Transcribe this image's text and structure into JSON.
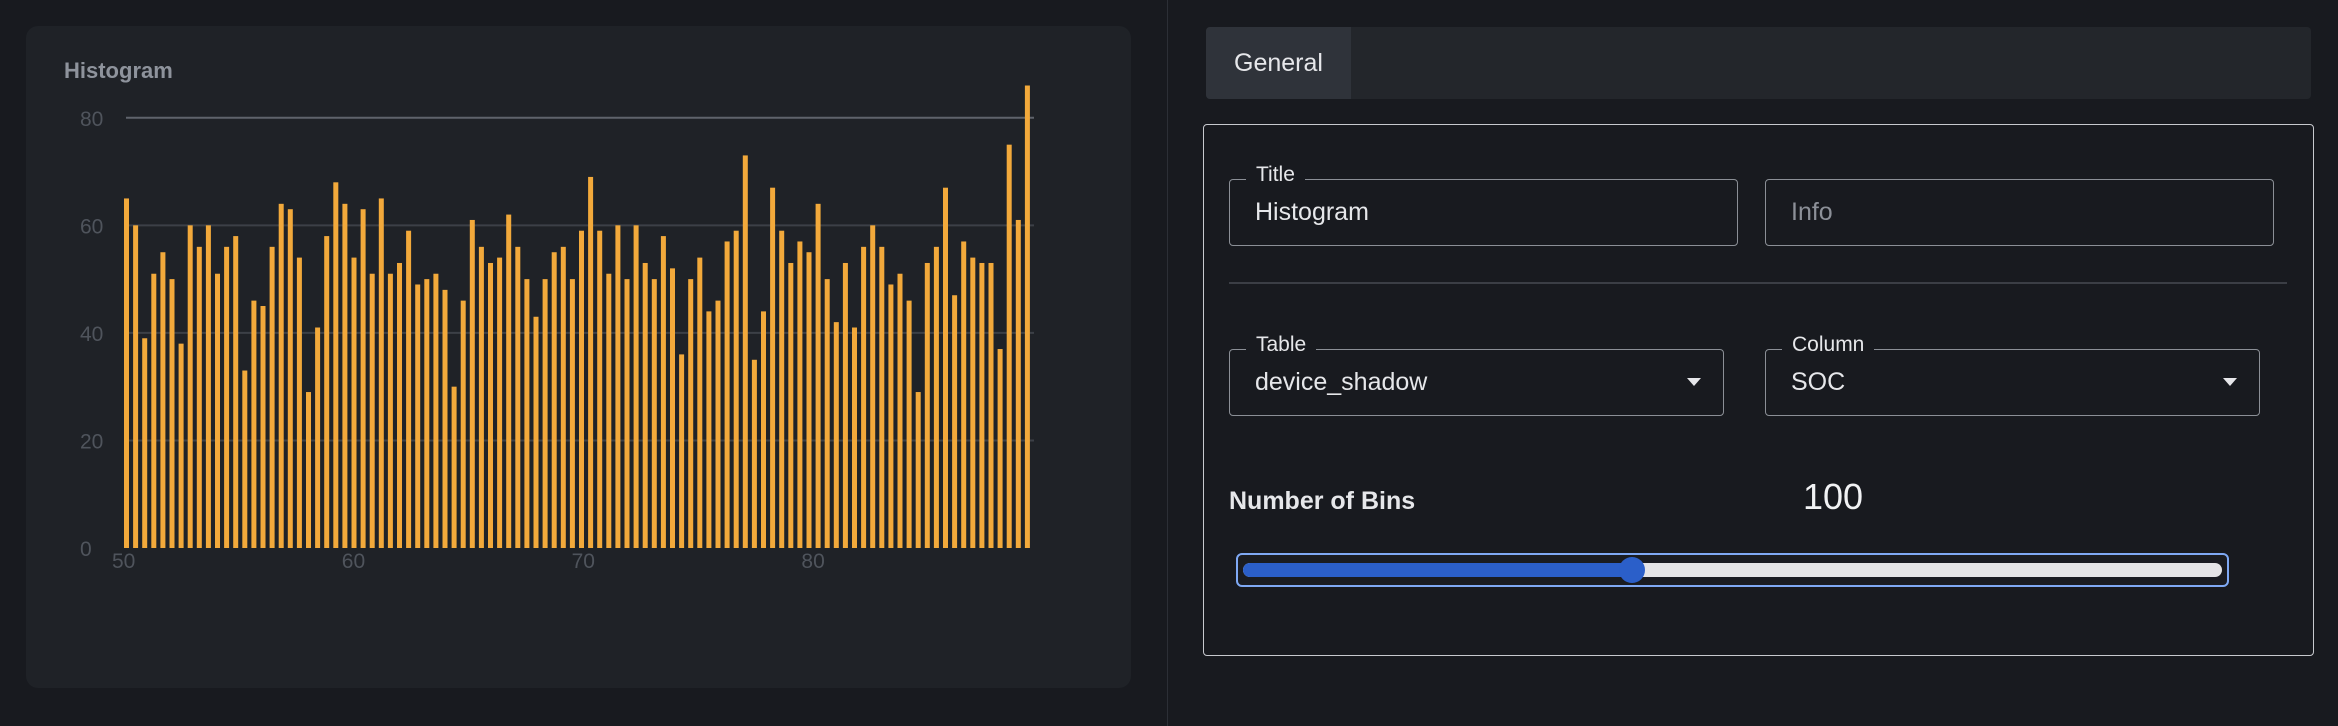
{
  "preview": {
    "title": "Histogram"
  },
  "chart_data": {
    "type": "bar",
    "title": "Histogram",
    "xlabel": "",
    "ylabel": "",
    "xlim": [
      50,
      89.6
    ],
    "ylim": [
      0,
      90
    ],
    "xticks": [
      50,
      60,
      70,
      80
    ],
    "yticks": [
      0,
      20,
      40,
      60,
      80
    ],
    "grid": true,
    "color": "#f2a93b",
    "values": [
      65,
      60,
      39,
      51,
      55,
      50,
      38,
      60,
      56,
      60,
      51,
      56,
      58,
      33,
      46,
      45,
      56,
      64,
      63,
      54,
      29,
      41,
      58,
      68,
      64,
      54,
      63,
      51,
      65,
      51,
      53,
      59,
      49,
      50,
      51,
      48,
      30,
      46,
      61,
      56,
      53,
      54,
      62,
      56,
      50,
      43,
      50,
      55,
      56,
      50,
      59,
      69,
      59,
      51,
      60,
      50,
      60,
      53,
      50,
      58,
      52,
      36,
      50,
      54,
      44,
      46,
      57,
      59,
      73,
      35,
      44,
      67,
      59,
      53,
      57,
      55,
      64,
      50,
      42,
      53,
      41,
      56,
      60,
      56,
      49,
      51,
      46,
      29,
      53,
      56,
      67,
      47,
      57,
      54,
      53,
      53,
      37,
      75,
      61,
      86
    ]
  },
  "tabs": [
    {
      "label": "General",
      "active": true
    }
  ],
  "form": {
    "title_field": {
      "legend": "Title",
      "value": "Histogram"
    },
    "info_field": {
      "placeholder": "Info"
    },
    "table_field": {
      "legend": "Table",
      "value": "device_shadow"
    },
    "column_field": {
      "legend": "Column",
      "value": "SOC"
    },
    "bins": {
      "label": "Number of Bins",
      "value": "100",
      "min": 1,
      "max": 250,
      "current": 100
    }
  },
  "colors": {
    "background": "#181a1f",
    "card": "#1f2227",
    "bar": "#f2a93b",
    "accent": "#2b5fc9"
  }
}
